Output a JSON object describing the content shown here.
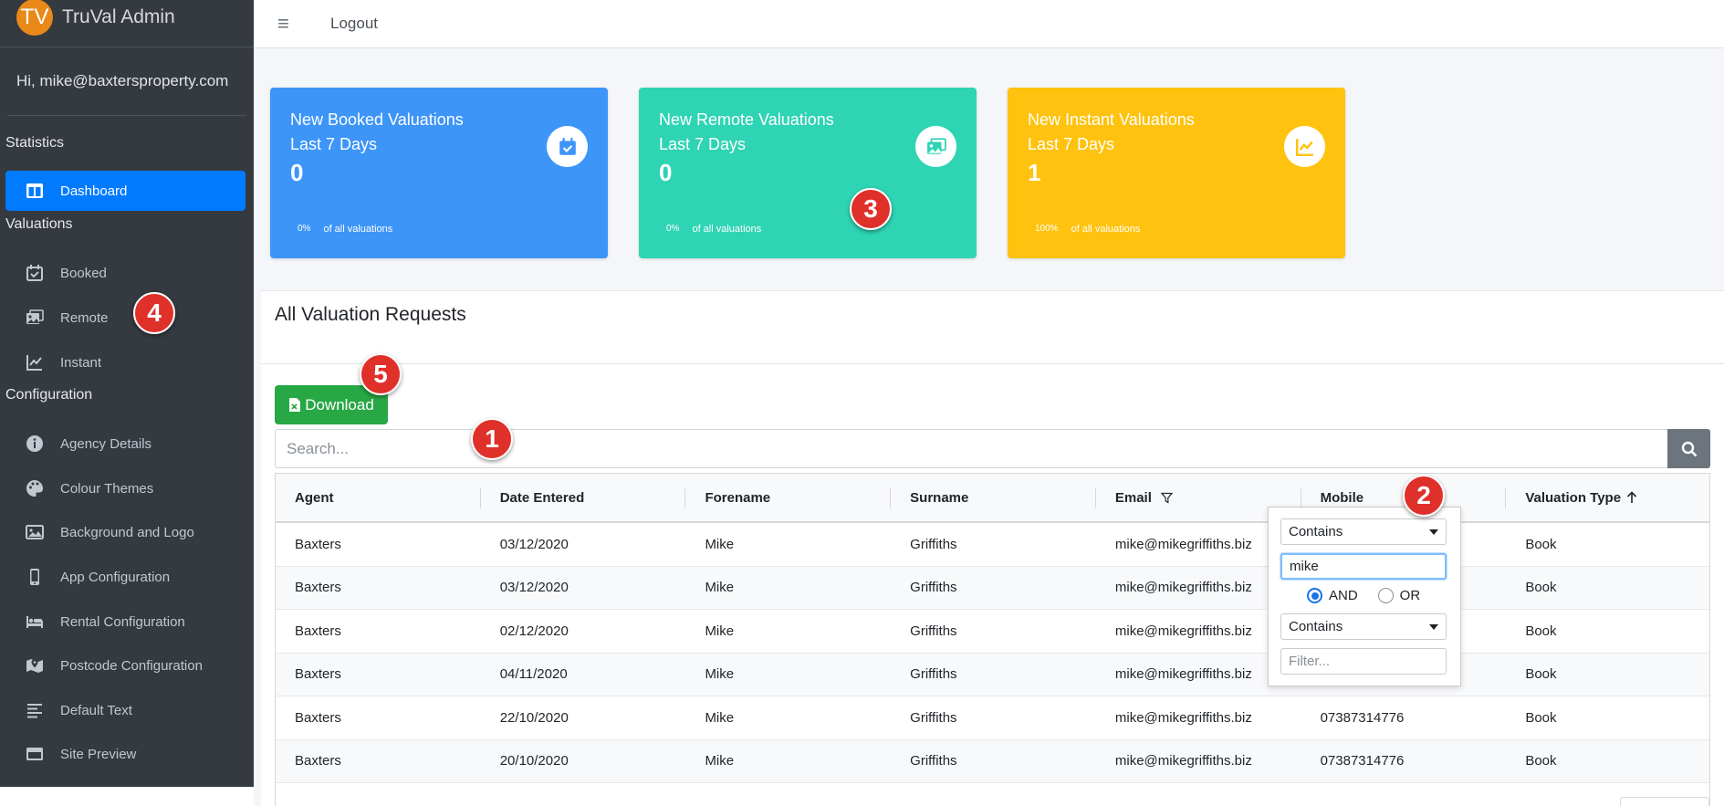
{
  "brand": {
    "logo_text": "TV",
    "title": "TruVal Admin"
  },
  "user": {
    "greeting": "Hi, mike@baxtersproperty.com"
  },
  "sidebar": {
    "sections": {
      "statistics": "Statistics",
      "valuations": "Valuations",
      "configuration": "Configuration"
    },
    "items": [
      {
        "label": "Dashboard",
        "icon": "dashboard-icon"
      },
      {
        "label": "Booked",
        "icon": "calendar-check-icon"
      },
      {
        "label": "Remote",
        "icon": "photo-images-icon"
      },
      {
        "label": "Instant",
        "icon": "line-chart-icon"
      },
      {
        "label": "Agency Details",
        "icon": "info-icon"
      },
      {
        "label": "Colour Themes",
        "icon": "palette-icon"
      },
      {
        "label": "Background and Logo",
        "icon": "image-icon"
      },
      {
        "label": "App Configuration",
        "icon": "mobile-icon"
      },
      {
        "label": "Rental Configuration",
        "icon": "bed-icon"
      },
      {
        "label": "Postcode Configuration",
        "icon": "map-marker-icon"
      },
      {
        "label": "Default Text",
        "icon": "text-align-icon"
      },
      {
        "label": "Site Preview",
        "icon": "window-icon"
      }
    ]
  },
  "topbar": {
    "menu_icon": "≡",
    "logout": "Logout"
  },
  "cards": [
    {
      "title_line1": "New Booked Valuations",
      "title_line2": "Last 7 Days",
      "count": "0",
      "pct": "0%",
      "pct_label": "of all valuations",
      "color": "#3d95f8",
      "icon": "calendar-check-icon"
    },
    {
      "title_line1": "New Remote Valuations",
      "title_line2": "Last 7 Days",
      "count": "0",
      "pct": "0%",
      "pct_label": "of all valuations",
      "color": "#2fd4b4",
      "icon": "photo-images-icon"
    },
    {
      "title_line1": "New Instant Valuations",
      "title_line2": "Last 7 Days",
      "count": "1",
      "pct": "100%",
      "pct_label": "of all valuations",
      "color": "#ffc20e",
      "icon": "line-chart-icon"
    }
  ],
  "main": {
    "title": "All Valuation Requests",
    "download_label": "Download",
    "search_placeholder": "Search...",
    "columns": [
      "Agent",
      "Date Entered",
      "Forename",
      "Surname",
      "Email",
      "Mobile",
      "Valuation Type"
    ],
    "rows": [
      [
        "Baxters",
        "03/12/2020",
        "Mike",
        "Griffiths",
        "mike@mikegriffiths.biz",
        "",
        "Book"
      ],
      [
        "Baxters",
        "03/12/2020",
        "Mike",
        "Griffiths",
        "mike@mikegriffiths.biz",
        "",
        "Book"
      ],
      [
        "Baxters",
        "02/12/2020",
        "Mike",
        "Griffiths",
        "mike@mikegriffiths.biz",
        "",
        "Book"
      ],
      [
        "Baxters",
        "04/11/2020",
        "Mike",
        "Griffiths",
        "mike@mikegriffiths.biz",
        "",
        "Book"
      ],
      [
        "Baxters",
        "22/10/2020",
        "Mike",
        "Griffiths",
        "mike@mikegriffiths.biz",
        "07387314776",
        "Book"
      ],
      [
        "Baxters",
        "20/10/2020",
        "Mike",
        "Griffiths",
        "mike@mikegriffiths.biz",
        "07387314776",
        "Book"
      ]
    ]
  },
  "filter_popup": {
    "operator1": "Contains",
    "value1": "mike",
    "logic_and": "AND",
    "logic_or": "OR",
    "logic_selected": "AND",
    "operator2": "Contains",
    "value2_placeholder": "Filter..."
  },
  "badges": [
    "1",
    "2",
    "3",
    "4",
    "5"
  ]
}
